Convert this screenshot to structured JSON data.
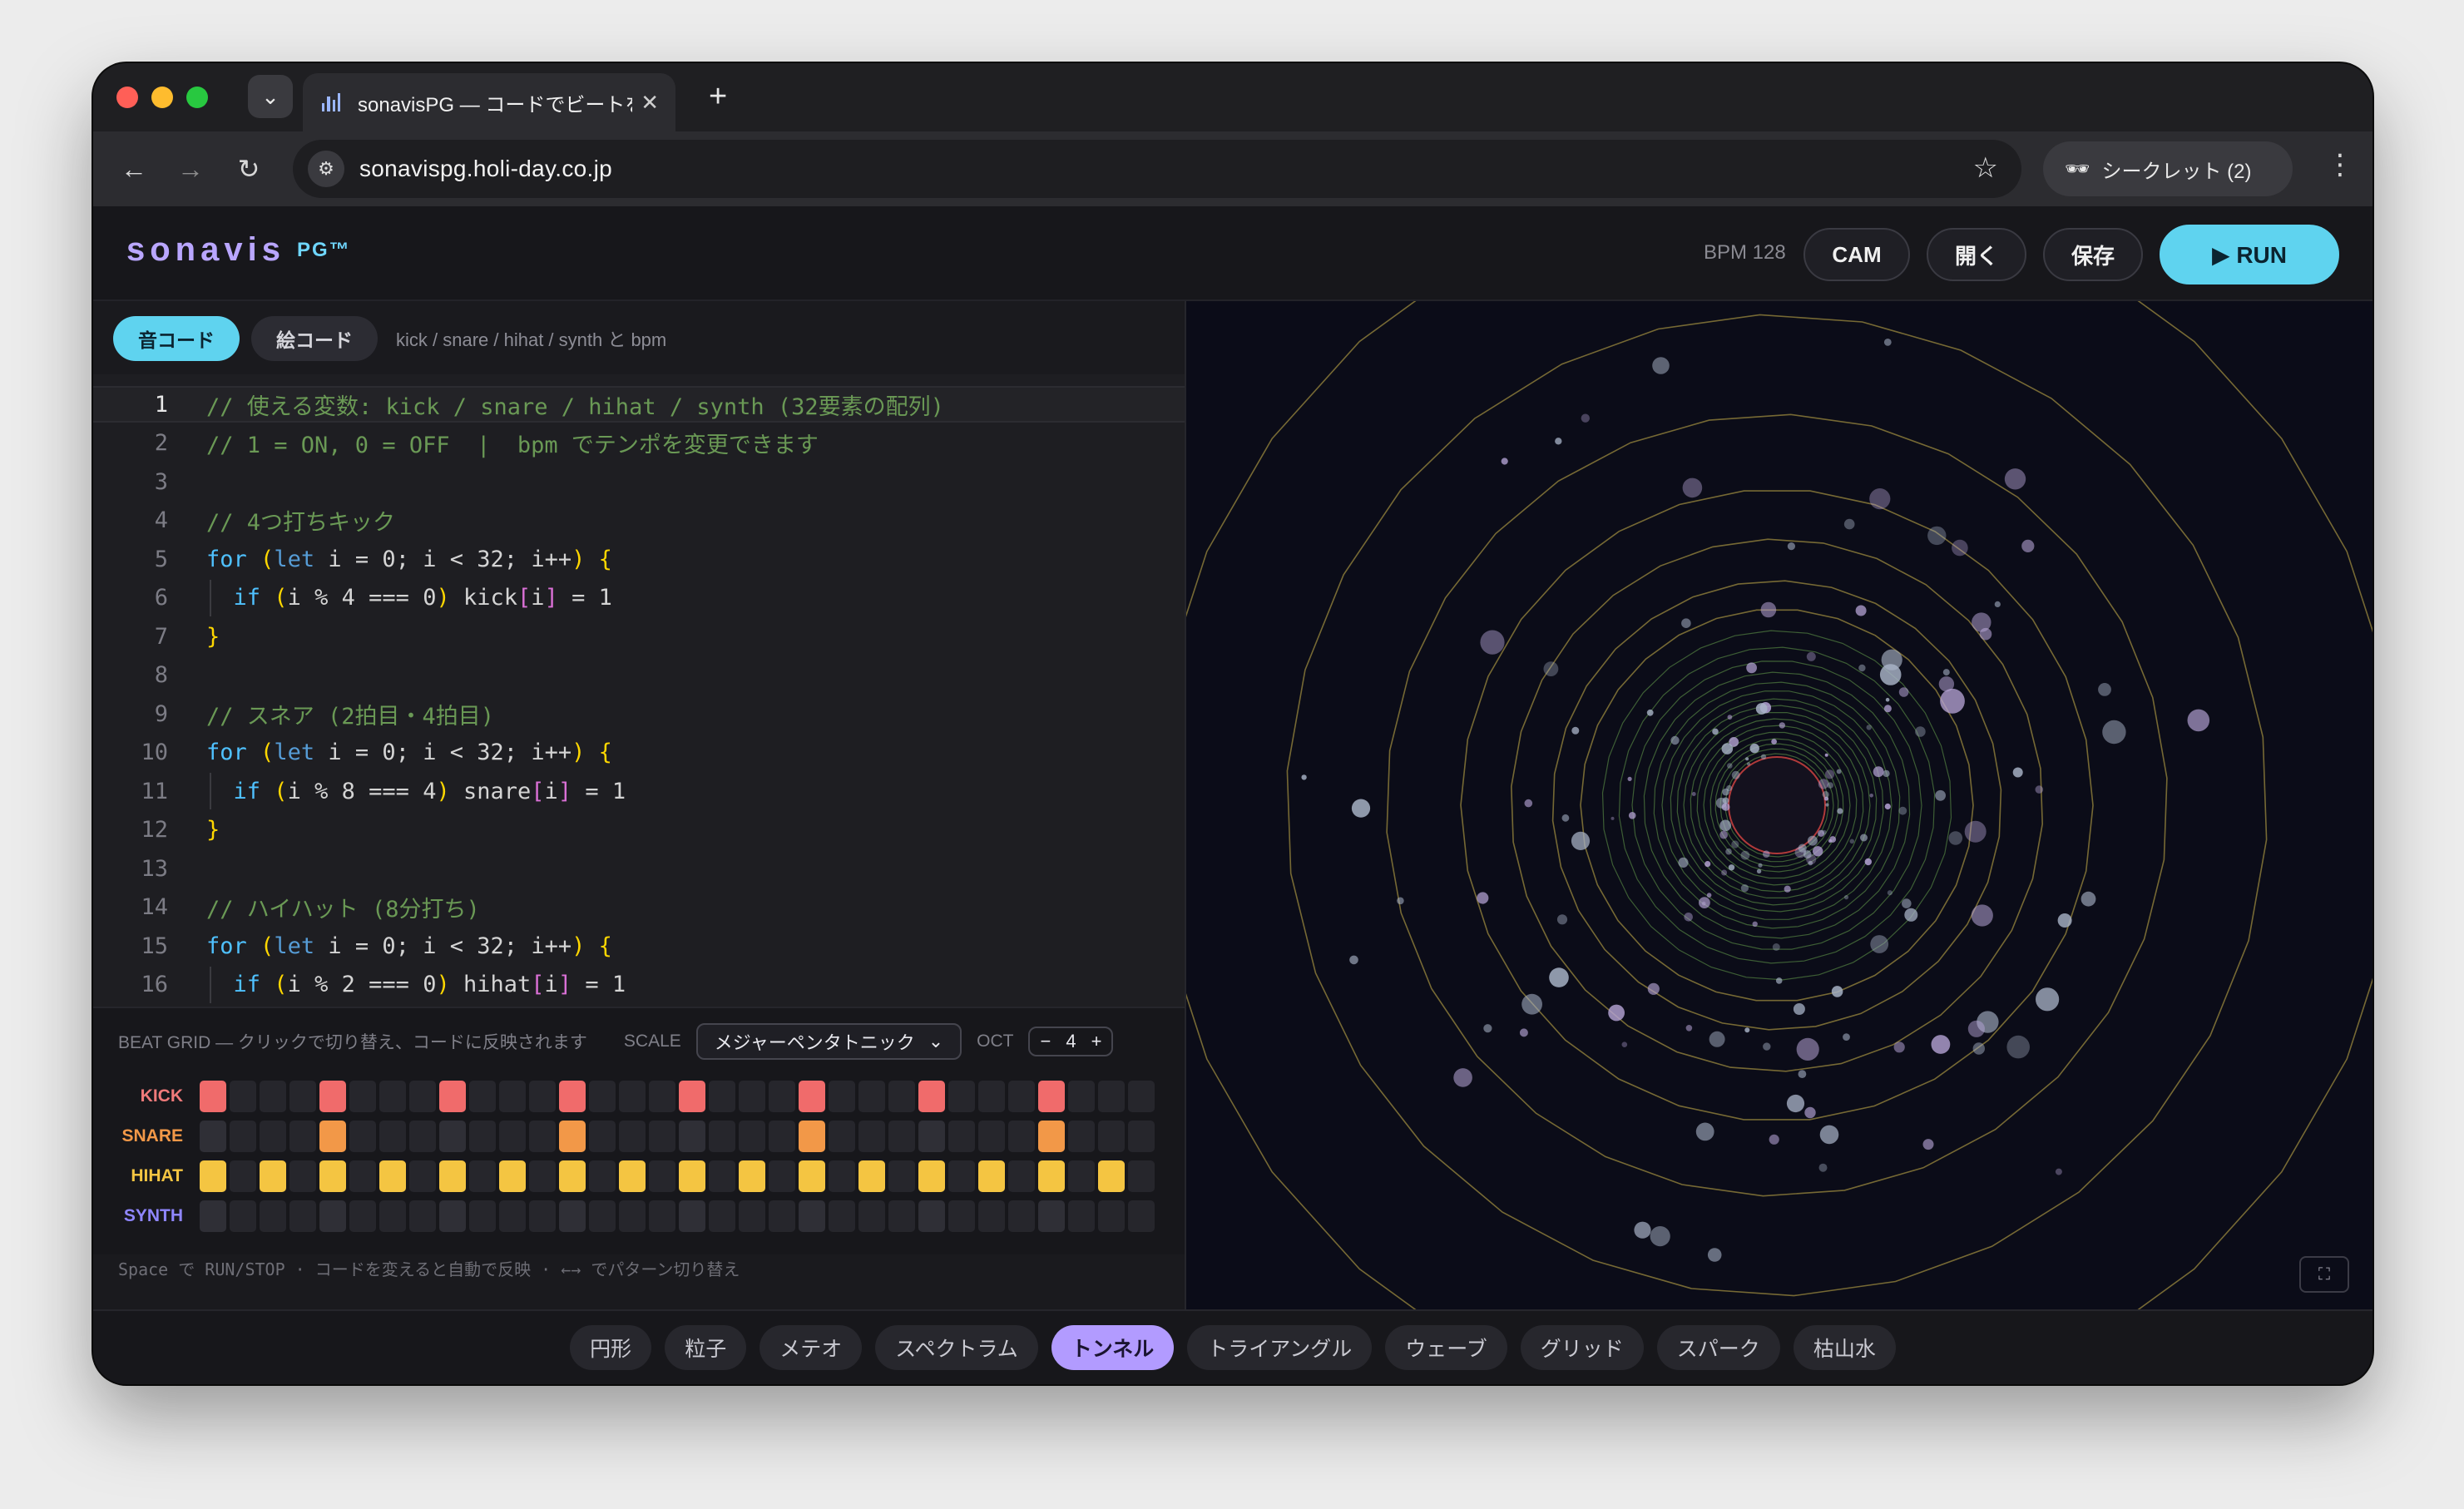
{
  "browser": {
    "tab_title": "sonavisPG — コードでビートを",
    "url": "sonavispg.holi-day.co.jp",
    "incognito_label": "シークレット (2)"
  },
  "header": {
    "logo": "sonavis",
    "logo_sub": "PG™",
    "bpm_label": "BPM 128",
    "cam_label": "CAM",
    "open_label": "開く",
    "save_label": "保存",
    "run_label": "▶ RUN"
  },
  "editor_tabs": {
    "sound_code": "音コード",
    "picture_code": "絵コード",
    "hint": "kick / snare / hihat / synth と bpm"
  },
  "code_lines": [
    "// 使える変数: kick / snare / hihat / synth (32要素の配列)",
    "// 1 = ON, 0 = OFF  |  bpm でテンポを変更できます",
    "",
    "// 4つ打ちキック",
    "for (let i = 0; i < 32; i++) {",
    "  if (i % 4 === 0) kick[i] = 1",
    "}",
    "",
    "// スネア (2拍目・4拍目)",
    "for (let i = 0; i < 32; i++) {",
    "  if (i % 8 === 4) snare[i] = 1",
    "}",
    "",
    "// ハイハット (8分打ち)",
    "for (let i = 0; i < 32; i++) {",
    "  if (i % 2 === 0) hihat[i] = 1",
    "}"
  ],
  "beat_grid": {
    "title": "BEAT GRID — クリックで切り替え、コードに反映されます",
    "scale_label": "SCALE",
    "scale_value": "メジャーペンタトニック",
    "oct_label": "OCT",
    "oct_value": "4",
    "oct_minus": "−",
    "oct_plus": "+",
    "tracks": [
      {
        "name": "KICK",
        "color": "#f06b6b",
        "label_color": "#f07a7a",
        "steps": [
          1,
          0,
          0,
          0,
          1,
          0,
          0,
          0,
          1,
          0,
          0,
          0,
          1,
          0,
          0,
          0,
          1,
          0,
          0,
          0,
          1,
          0,
          0,
          0,
          1,
          0,
          0,
          0,
          1,
          0,
          0,
          0
        ]
      },
      {
        "name": "SNARE",
        "color": "#f29848",
        "label_color": "#f29848",
        "steps": [
          0,
          0,
          0,
          0,
          1,
          0,
          0,
          0,
          0,
          0,
          0,
          0,
          1,
          0,
          0,
          0,
          0,
          0,
          0,
          0,
          1,
          0,
          0,
          0,
          0,
          0,
          0,
          0,
          1,
          0,
          0,
          0
        ]
      },
      {
        "name": "HIHAT",
        "color": "#f4c542",
        "label_color": "#f4c542",
        "steps": [
          1,
          0,
          1,
          0,
          1,
          0,
          1,
          0,
          1,
          0,
          1,
          0,
          1,
          0,
          1,
          0,
          1,
          0,
          1,
          0,
          1,
          0,
          1,
          0,
          1,
          0,
          1,
          0,
          1,
          0,
          1,
          0
        ]
      },
      {
        "name": "SYNTH",
        "color": "#8f86ff",
        "label_color": "#8f86ff",
        "steps": [
          0,
          0,
          0,
          0,
          0,
          0,
          0,
          0,
          0,
          0,
          0,
          0,
          0,
          0,
          0,
          0,
          0,
          0,
          0,
          0,
          0,
          0,
          0,
          0,
          0,
          0,
          0,
          0,
          0,
          0,
          0,
          0
        ]
      }
    ]
  },
  "footer_hint": "Space で RUN/STOP · コードを変えると自動で反映 · ←→ でパターン切り替え",
  "modes": [
    {
      "label": "円形",
      "active": false
    },
    {
      "label": "粒子",
      "active": false
    },
    {
      "label": "メテオ",
      "active": false
    },
    {
      "label": "スペクトラム",
      "active": false
    },
    {
      "label": "トンネル",
      "active": true
    },
    {
      "label": "トライアングル",
      "active": false
    },
    {
      "label": "ウェーブ",
      "active": false
    },
    {
      "label": "グリッド",
      "active": false
    },
    {
      "label": "スパーク",
      "active": false
    },
    {
      "label": "枯山水",
      "active": false
    }
  ],
  "colors": {
    "accent": "#5fd3ef",
    "mode_active": "#b29bff",
    "tunnel_ring": "#8a7a3a",
    "tunnel_core": "#b03a3a"
  }
}
